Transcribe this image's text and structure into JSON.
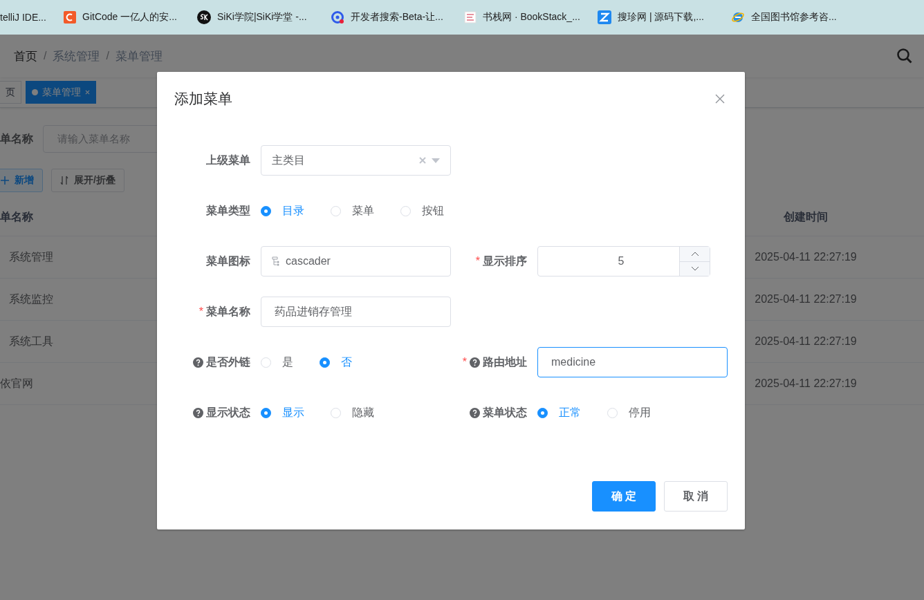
{
  "bookmarks": [
    {
      "kind": "none",
      "title": "telliJ IDE..."
    },
    {
      "kind": "gitcode",
      "title": "GitCode 一亿人的安..."
    },
    {
      "kind": "siki",
      "title": "SiKi学院|SiKi学堂 -..."
    },
    {
      "kind": "search",
      "title": "开发者搜索-Beta-让..."
    },
    {
      "kind": "book",
      "title": "书栈网 · BookStack_..."
    },
    {
      "kind": "zhen",
      "title": "搜珍网 | 源码下载,..."
    },
    {
      "kind": "ie",
      "title": "全国图书馆参考咨..."
    }
  ],
  "breadcrumb": [
    {
      "label": "首页",
      "link": true
    },
    {
      "separator": "/",
      "label": "系统管理",
      "link": false
    },
    {
      "separator": "/",
      "label": "菜单管理",
      "link": false
    }
  ],
  "tags": [
    {
      "label": "页",
      "selected": false
    },
    {
      "label": "菜单管理",
      "selected": true
    }
  ],
  "search": {
    "label": "单名称",
    "placeholder": "请输入菜单名称"
  },
  "toolbar": [
    {
      "kind": "add",
      "label": "新增"
    },
    {
      "kind": "toggle",
      "label": "展开/折叠"
    }
  ],
  "table": {
    "columns": [
      {
        "label": "单名称"
      },
      {
        "label": "创建时间"
      }
    ],
    "rows": [
      {
        "name": "系统管理",
        "created": "2025-04-11 22:27:19"
      },
      {
        "name": "系统监控",
        "created": "2025-04-11 22:27:19"
      },
      {
        "name": "系统工具",
        "created": "2025-04-11 22:27:19"
      },
      {
        "name": "依官网",
        "created": "2025-04-11 22:27:19"
      }
    ]
  },
  "dialog": {
    "title": "添加菜单",
    "rows": [
      [
        {
          "kind": "select",
          "label": "上级菜单",
          "help": false,
          "value": "主类目"
        }
      ],
      [
        {
          "kind": "radio",
          "label": "菜单类型",
          "help": false,
          "options": [
            {
              "label": "目录",
              "selected": true
            },
            {
              "label": "菜单",
              "selected": false
            },
            {
              "label": "按钮",
              "selected": false
            }
          ]
        }
      ],
      [
        {
          "kind": "icon",
          "label": "菜单图标",
          "help": false,
          "value": "cascader"
        },
        {
          "kind": "number",
          "required_mark": "*",
          "label": "显示排序",
          "help": false,
          "value": "5"
        }
      ],
      [
        {
          "kind": "text",
          "required_mark": "*",
          "label": "菜单名称",
          "help": false,
          "value": "药品进销存管理",
          "focused": false
        }
      ],
      [
        {
          "kind": "radio",
          "label": "是否外链",
          "help": true,
          "options": [
            {
              "label": "是",
              "selected": false
            },
            {
              "label": "否",
              "selected": true
            }
          ]
        },
        {
          "kind": "text",
          "required_mark": "*",
          "label": "路由地址",
          "help": true,
          "value": "medicine",
          "focused": true
        }
      ],
      [
        {
          "kind": "radio",
          "label": "显示状态",
          "help": true,
          "options": [
            {
              "label": "显示",
              "selected": true
            },
            {
              "label": "隐藏",
              "selected": false
            }
          ]
        },
        {
          "kind": "radio",
          "label": "菜单状态",
          "help": true,
          "options": [
            {
              "label": "正常",
              "selected": true
            },
            {
              "label": "停用",
              "selected": false
            }
          ]
        }
      ]
    ],
    "buttons": [
      {
        "kind": "primary",
        "label": "确 定"
      },
      {
        "kind": "default",
        "label": "取 消"
      }
    ]
  }
}
